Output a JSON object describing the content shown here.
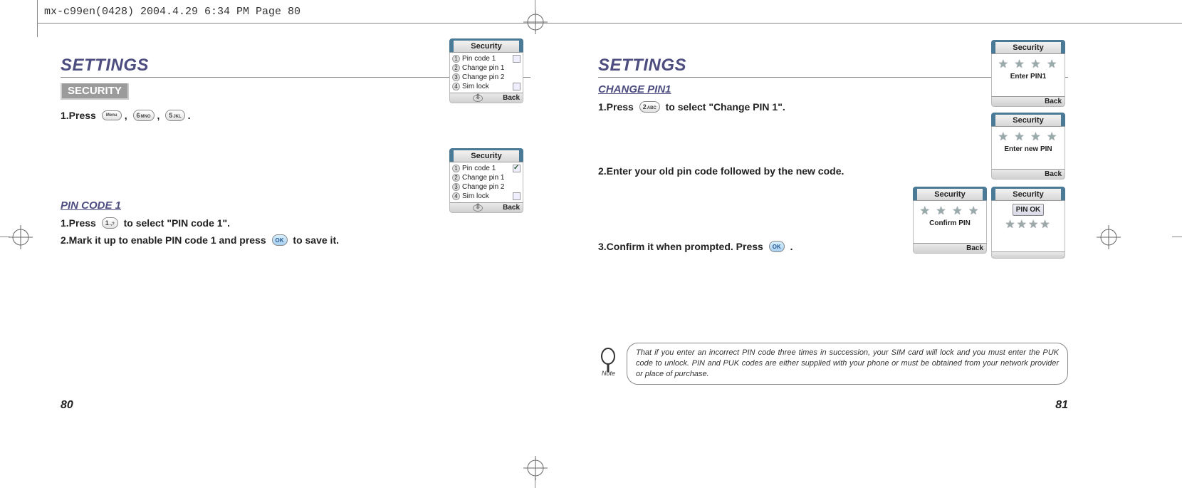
{
  "header_slug": "mx-c99en(0428)  2004.4.29  6:34 PM  Page 80",
  "left": {
    "title": "SETTINGS",
    "section_label": "SECURITY",
    "step1_a": "1.Press ",
    "step1_menu": "Menu",
    "step1_sep": ", ",
    "step1_key6": "6",
    "step1_key6s": "MNO",
    "step1_key5": "5",
    "step1_key5s": "JKL",
    "step1_end": ".",
    "sub1": "PIN CODE 1",
    "p1s1_a": "1.Press ",
    "p1s1_keytop": "1",
    "p1s1_keysub": ".,?",
    "p1s1_b": " to select \"PIN code 1\".",
    "p1s2_a": "2.Mark it up to enable PIN code 1 and press ",
    "p1s2_ok": "OK",
    "p1s2_b": " to save it.",
    "page_num": "80",
    "phone1": {
      "title": "Security",
      "items": [
        "Pin code 1",
        "Change pin 1",
        "Change pin 2",
        "Sim lock"
      ],
      "back": "Back"
    },
    "phone2": {
      "title": "Security",
      "items": [
        "Pin code 1",
        "Change pin 1",
        "Change pin 2",
        "Sim lock"
      ],
      "back": "Back"
    }
  },
  "right": {
    "title": "SETTINGS",
    "sub1": "CHANGE PIN1",
    "s1_a": "1.Press ",
    "s1_keytop": "2",
    "s1_keysub": "ABC",
    "s1_b": " to select \"Change PIN 1\".",
    "s2": "2.Enter your old pin code followed by the new code.",
    "s3_a": "3.Confirm it when prompted. Press ",
    "s3_ok": "OK",
    "s3_b": " .",
    "note": "That if you enter an incorrect PIN code three times in succession, your SIM card will lock and you must enter the PUK code to unlock. PIN and PUK codes are either supplied with your phone or must be obtained from your network provider or place of purchase.",
    "note_label": "Note",
    "page_num": "81",
    "ph_enter_pin1": {
      "title": "Security",
      "msg": "Enter PIN1",
      "back": "Back"
    },
    "ph_enter_new": {
      "title": "Security",
      "msg": "Enter new PIN",
      "back": "Back"
    },
    "ph_confirm": {
      "title": "Security",
      "msg": "Confirm PIN",
      "back": "Back"
    },
    "ph_ok": {
      "title": "Security",
      "ok": "PIN OK"
    }
  }
}
